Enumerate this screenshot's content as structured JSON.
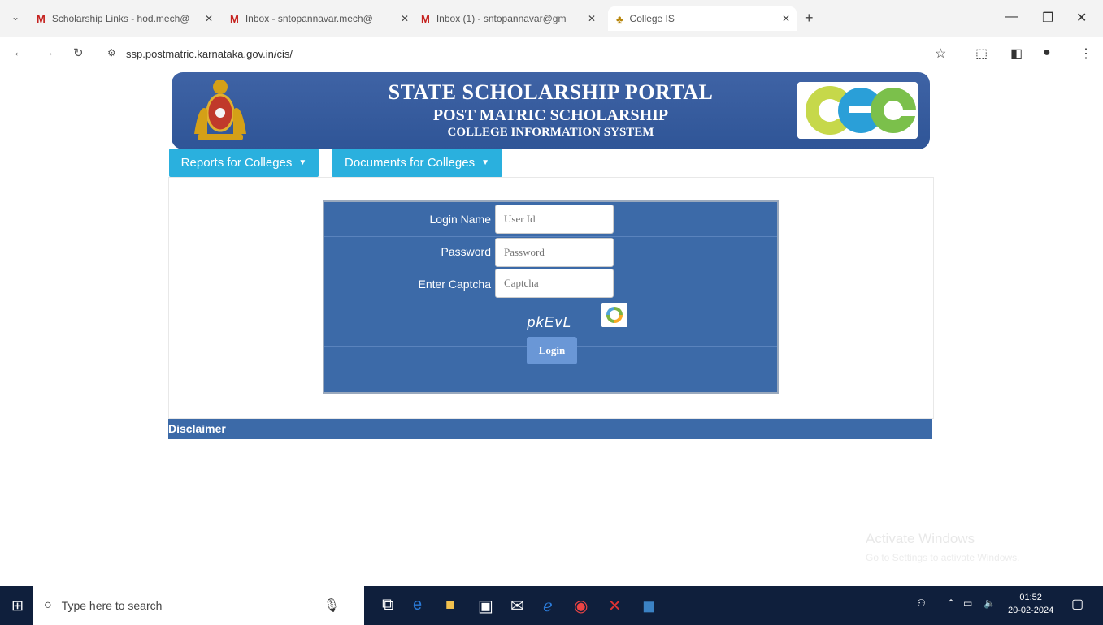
{
  "browser": {
    "tabs": [
      {
        "title": "Scholarship Links - hod.mech@",
        "favicon": "gmail-icon"
      },
      {
        "title": "Inbox - sntopannavar.mech@",
        "favicon": "gmail-icon"
      },
      {
        "title": "Inbox (1) - sntopannavar@gm",
        "favicon": "gmail-icon"
      },
      {
        "title": "College IS",
        "favicon": "emblem-icon"
      }
    ],
    "url": "ssp.postmatric.karnataka.gov.in/cis/"
  },
  "banner": {
    "title": "STATE SCHOLARSHIP PORTAL",
    "subtitle": "POST MATRIC SCHOLARSHIP",
    "subtitle2": "COLLEGE INFORMATION SYSTEM"
  },
  "menu": {
    "reports_label": "Reports for Colleges",
    "documents_label": "Documents for Colleges"
  },
  "login": {
    "login_name_label": "Login Name",
    "login_name_placeholder": "User Id",
    "password_label": "Password",
    "password_placeholder": "Password",
    "captcha_label": "Enter Captcha",
    "captcha_placeholder": "Captcha",
    "captcha_text": "pkEvL",
    "login_button": "Login"
  },
  "disclaimer": "Disclaimer",
  "watermark": {
    "line1": "Activate Windows",
    "line2": "Go to Settings to activate Windows."
  },
  "taskbar": {
    "search_placeholder": "Type here to search",
    "time": "01:52",
    "date": "20-02-2024"
  }
}
